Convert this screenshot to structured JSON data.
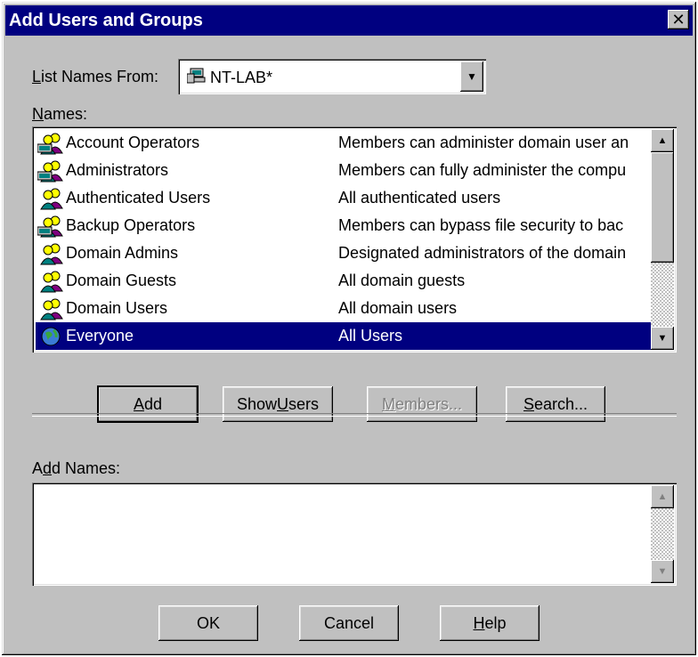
{
  "dialog": {
    "title": "Add Users and Groups",
    "close_symbol": "✕"
  },
  "list_names_from": {
    "label_prefix": "",
    "label_mnemonic": "L",
    "label_rest": "ist Names From:",
    "value": "NT-LAB*",
    "icon": "computer-icon"
  },
  "names": {
    "label_mnemonic": "N",
    "label_rest": "ames:",
    "rows": [
      {
        "name": "Account Operators",
        "description": "Members can administer domain user an",
        "icon": "local-group-icon"
      },
      {
        "name": "Administrators",
        "description": "Members can fully administer the compu",
        "icon": "local-group-icon"
      },
      {
        "name": "Authenticated Users",
        "description": "All authenticated users",
        "icon": "global-group-icon"
      },
      {
        "name": "Backup Operators",
        "description": "Members can bypass file security to bac",
        "icon": "local-group-icon"
      },
      {
        "name": "Domain Admins",
        "description": "Designated administrators of the domain",
        "icon": "global-group-icon"
      },
      {
        "name": "Domain Guests",
        "description": "All domain guests",
        "icon": "global-group-icon"
      },
      {
        "name": "Domain Users",
        "description": "All domain users",
        "icon": "global-group-icon"
      },
      {
        "name": "Everyone",
        "description": "All Users",
        "icon": "globe-icon",
        "selected": true
      }
    ]
  },
  "buttons": {
    "add": {
      "mnemonic": "A",
      "rest": "dd"
    },
    "show_users": {
      "before": "Show ",
      "mnemonic": "U",
      "rest": "sers"
    },
    "members": {
      "mnemonic": "M",
      "rest": "embers..."
    },
    "search": {
      "mnemonic": "S",
      "rest": "earch..."
    },
    "ok": "OK",
    "cancel": "Cancel",
    "help": {
      "mnemonic": "H",
      "rest": "elp"
    }
  },
  "add_names": {
    "label_before": "A",
    "label_mnemonic": "d",
    "label_rest": "d Names:",
    "value": ""
  },
  "colors": {
    "titlebar": "#000080",
    "face": "#c0c0c0",
    "selection": "#000080"
  }
}
